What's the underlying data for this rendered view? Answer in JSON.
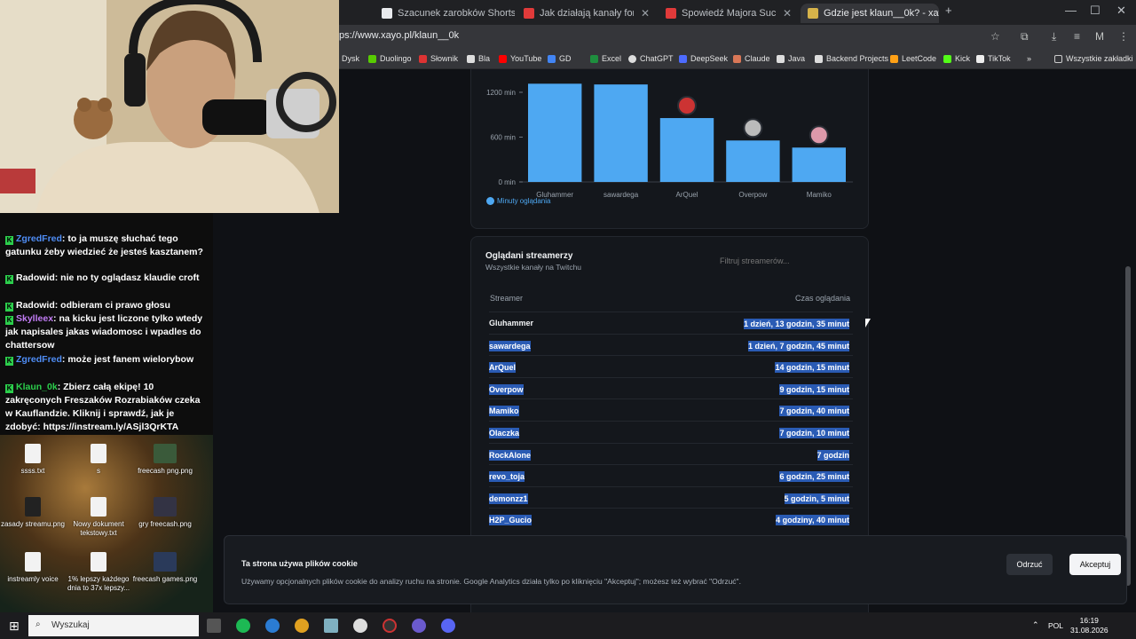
{
  "browser": {
    "tabs": [
      {
        "label": "Szacunek zarobków Shortsów",
        "active": false
      },
      {
        "label": "Jak działają kanały forum na Di",
        "active": false
      },
      {
        "label": "Spowiedź Majora Suchodolskie",
        "active": false
      },
      {
        "label": "Gdzie jest klaun__0k? - xayo.pl",
        "active": true
      }
    ],
    "url": "ps://www.xayo.pl/klaun__0k",
    "bookmarks": [
      "Dysk",
      "Duolingo",
      "Słownik",
      "Bla",
      "YouTube",
      "GD",
      "Excel",
      "ChatGPT",
      "DeepSeek",
      "Claude",
      "Java",
      "Backend Projects",
      "LeetCode",
      "Kick",
      "TikTok"
    ],
    "all_bookmarks": "Wszystkie zakładki"
  },
  "chart_data": {
    "type": "bar",
    "categories": [
      "Gluhammer",
      "sawardega",
      "ArQuel",
      "Overpow",
      "Mamiko"
    ],
    "values": [
      1315,
      1305,
      855,
      555,
      460
    ],
    "ylim": [
      0,
      1200
    ],
    "yticks": [
      "0 min",
      "600 min",
      "1200 min"
    ],
    "series_name": "Minuty oglądania",
    "bar_color": "#4ea8f2"
  },
  "table": {
    "title": "Oglądani streamerzy",
    "subtitle": "Wszystkie kanały na Twitchu",
    "filter_placeholder": "Filtruj streamerów...",
    "col_streamer": "Streamer",
    "col_time": "Czas oglądania",
    "rows": [
      {
        "name": "Gluhammer",
        "time": "1 dzień, 13 godzin, 35 minut"
      },
      {
        "name": "sawardega",
        "time": "1 dzień, 7 godzin, 45 minut"
      },
      {
        "name": "ArQuel",
        "time": "14 godzin, 15 minut"
      },
      {
        "name": "Overpow",
        "time": "9 godzin, 15 minut"
      },
      {
        "name": "Mamiko",
        "time": "7 godzin, 40 minut"
      },
      {
        "name": "Olaczka",
        "time": "7 godzin, 10 minut"
      },
      {
        "name": "RockAlone",
        "time": "7 godzin"
      },
      {
        "name": "revo_toja",
        "time": "6 godzin, 25 minut"
      },
      {
        "name": "demonzz1",
        "time": "5 godzin, 5 minut"
      },
      {
        "name": "H2P_Gucio",
        "time": "4 godziny, 40 minut"
      }
    ]
  },
  "cookie": {
    "title": "Ta strona używa plików cookie",
    "text": "Używamy opcjonalnych plików cookie do analizy ruchu na stronie. Google Analytics działa tylko po kliknięciu \"Akceptuj\"; możesz też wybrać \"Odrzuć\".",
    "refuse": "Odrzuć",
    "accept": "Akceptuj"
  },
  "chat": [
    {
      "user": "ZgredFred",
      "color": "#4f8df5",
      "text": "to ja muszę słuchać tego gatunku żeby wiedzieć że jesteś kasztanem?"
    },
    {
      "user": "Radowid",
      "color": "#ffffff",
      "text": "nie no ty oglądasz klaudie croft"
    },
    {
      "user": "Radowid",
      "color": "#ffffff",
      "text": "odbieram ci prawo głosu"
    },
    {
      "user": "Skylleex",
      "color": "#c27cf5",
      "text": "na kicku jest liczone tylko wtedy jak napisales jakas wiadomosc i wpadles do chattersow"
    },
    {
      "user": "ZgredFred",
      "color": "#4f8df5",
      "text": "może jest fanem wielorybow"
    },
    {
      "user": "Klaun_0k",
      "color": "#2cce4c",
      "text": "Zbierz całą ekipę! 10 zakręconych Freszaków Rozrabiaków czeka w Kauflandzie. Kliknij i sprawdź, jak je zdobyć: https://instream.ly/ASjl3QrKTA"
    }
  ],
  "desktop_icons": [
    "ssss.txt",
    "s",
    "freecash png.png",
    "zasady streamu.png",
    "Nowy dokument tekstowy.txt",
    "gry freecash.png",
    "instreamly voice",
    "1% lepszy każdego dnia to 37x lepszy...",
    "freecash games.png"
  ],
  "taskbar": {
    "search": "Wyszukaj",
    "lang": "POL",
    "time": "16:19",
    "date": "31.08.2026"
  }
}
